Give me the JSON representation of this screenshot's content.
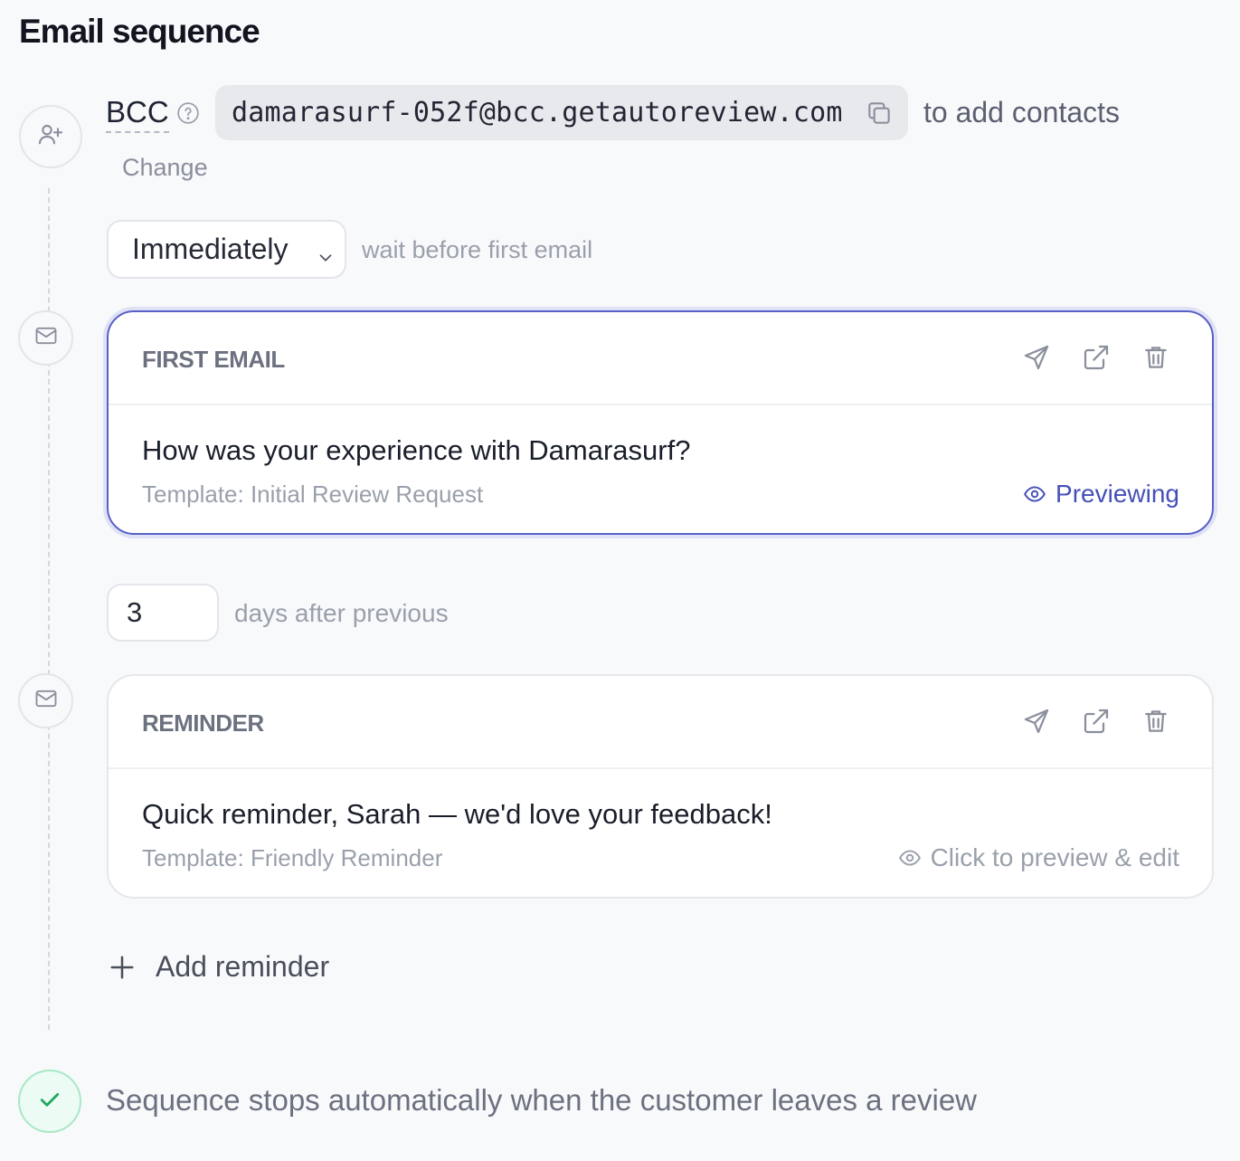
{
  "page": {
    "title": "Email sequence"
  },
  "bcc": {
    "label": "BCC",
    "address": "damarasurf-052f@bcc.getautoreview.com",
    "suffix": "to add contacts",
    "change_label": "Change",
    "icons": {
      "help": "help-circle-icon",
      "copy": "copy-icon",
      "node": "user-plus-icon"
    }
  },
  "initial_delay": {
    "selected": "Immediately",
    "label": "wait before first email"
  },
  "emails": [
    {
      "kind": "FIRST EMAIL",
      "subject": "How was your experience with Damarasurf?",
      "template": "Template: Initial Review Request",
      "status": "Previewing",
      "active": true
    },
    {
      "kind": "REMINDER",
      "subject": "Quick reminder, Sarah — we'd love your feedback!",
      "template": "Template: Friendly Reminder",
      "status": "Click to preview & edit",
      "active": false
    }
  ],
  "reminder_delay": {
    "value": "3",
    "label": "days after previous"
  },
  "add_reminder_label": "Add reminder",
  "footer": {
    "stop_text": "Sequence stops automatically when the customer leaves a review"
  },
  "colors": {
    "accent": "#4550b8",
    "success": "#22a862",
    "background": "#f8f9fb"
  }
}
